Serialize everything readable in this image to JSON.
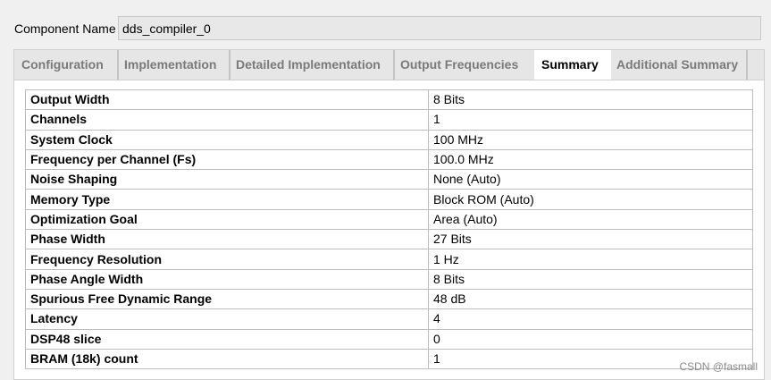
{
  "component": {
    "label": "Component Name",
    "value": "dds_compiler_0"
  },
  "tabs": [
    {
      "label": "Configuration",
      "active": false
    },
    {
      "label": "Implementation",
      "active": false
    },
    {
      "label": "Detailed Implementation",
      "active": false
    },
    {
      "label": "Output Frequencies",
      "active": false
    },
    {
      "label": "Summary",
      "active": true
    },
    {
      "label": "Additional Summary",
      "active": false
    }
  ],
  "summary": {
    "rows": [
      {
        "key": "Output Width",
        "value": "8 Bits"
      },
      {
        "key": "Channels",
        "value": "1"
      },
      {
        "key": "System Clock",
        "value": "100 MHz"
      },
      {
        "key": "Frequency per Channel (Fs)",
        "value": "100.0 MHz"
      },
      {
        "key": "Noise Shaping",
        "value": "None (Auto)"
      },
      {
        "key": "Memory Type",
        "value": "Block ROM (Auto)"
      },
      {
        "key": "Optimization Goal",
        "value": "Area (Auto)"
      },
      {
        "key": "Phase Width",
        "value": "27 Bits"
      },
      {
        "key": "Frequency Resolution",
        "value": "1 Hz"
      },
      {
        "key": "Phase Angle Width",
        "value": "8 Bits"
      },
      {
        "key": "Spurious Free Dynamic Range",
        "value": "48 dB"
      },
      {
        "key": "Latency",
        "value": "4"
      },
      {
        "key": "DSP48 slice",
        "value": "0"
      },
      {
        "key": "BRAM (18k) count",
        "value": "1"
      }
    ]
  },
  "watermark": "CSDN @fasmall"
}
